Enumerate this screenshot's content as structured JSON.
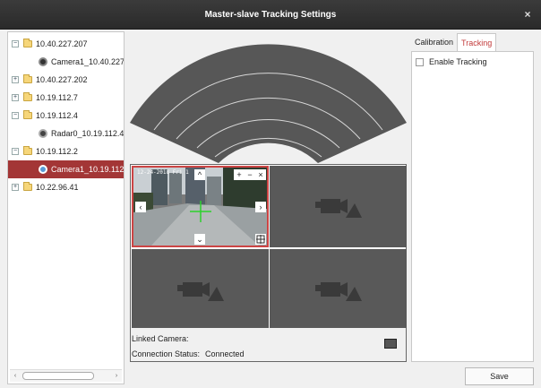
{
  "window": {
    "title": "Master-slave Tracking Settings",
    "close_glyph": "×"
  },
  "tree": {
    "items": [
      {
        "label": "10.40.227.207",
        "expander": "−"
      },
      {
        "label": "Camera1_10.40.227"
      },
      {
        "label": "10.40.227.202",
        "expander": "+"
      },
      {
        "label": "10.19.112.7",
        "expander": "+"
      },
      {
        "label": "10.19.112.4",
        "expander": "−"
      },
      {
        "label": "Radar0_10.19.112.4"
      },
      {
        "label": "10.19.112.2",
        "expander": "−"
      },
      {
        "label": "Camera1_10.19.112"
      },
      {
        "label": "10.22.96.41",
        "expander": "+"
      }
    ],
    "scroll_left": "‹",
    "scroll_right": "›"
  },
  "video": {
    "osd": "12-24-2018 Fri 1",
    "buttons": {
      "up": "^",
      "down": "⌄",
      "left": "‹",
      "right": "›",
      "zoom_in": "+",
      "zoom_out": "−",
      "close": "×"
    }
  },
  "info": {
    "linked_camera_label": "Linked Camera:",
    "connection_status_label": "Connection Status:",
    "connection_status_value": "Connected"
  },
  "tabs": [
    {
      "label": "Calibration"
    },
    {
      "label": "Tracking"
    }
  ],
  "tracking": {
    "enable_label": "Enable Tracking"
  },
  "footer": {
    "save_label": "Save"
  },
  "colors": {
    "accent": "#a33636",
    "titlebar": "#2f2f2f",
    "fan": "#575757"
  }
}
